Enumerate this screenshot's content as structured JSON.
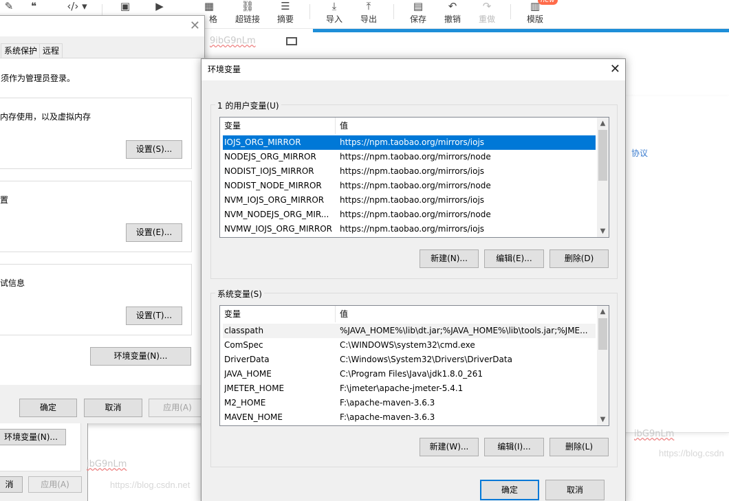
{
  "toolbar": {
    "items": [
      {
        "icon": "quote-icon",
        "glyph": "❝",
        "label": ""
      },
      {
        "icon": "code-icon",
        "glyph": "‹/›",
        "label": ""
      },
      {
        "icon": "image-icon",
        "glyph": "▣",
        "label": ""
      },
      {
        "icon": "video-icon",
        "glyph": "▶",
        "label": ""
      },
      {
        "icon": "table-icon",
        "glyph": "▦",
        "label": "格"
      },
      {
        "icon": "link-icon",
        "glyph": "⛓",
        "label": "超链接"
      },
      {
        "icon": "summary-icon",
        "glyph": "☰",
        "label": "摘要"
      },
      {
        "icon": "import-icon",
        "glyph": "⤓",
        "label": "导入"
      },
      {
        "icon": "export-icon",
        "glyph": "⤒",
        "label": "导出"
      },
      {
        "icon": "save-icon",
        "glyph": "▤",
        "label": "保存"
      },
      {
        "icon": "undo-icon",
        "glyph": "↶",
        "label": "撤销"
      },
      {
        "icon": "redo-icon",
        "glyph": "↷",
        "label": "重做"
      },
      {
        "icon": "template-icon",
        "glyph": "▥",
        "label": "模版"
      }
    ],
    "new_badge": "new"
  },
  "background": {
    "link_text": "协议",
    "watermark": "https://blog.csdn.net",
    "watermark_right": "https://blog.csdn",
    "squiggle1": "9ibG9nLm",
    "squiggle2": "ibG9nLm",
    "squiggle3": "ibG9nLm"
  },
  "sysprop": {
    "tabs": [
      "系统保护",
      "远程"
    ],
    "admin_note": "须作为管理员登录。",
    "perf_text": "内存使用，以及虚拟内存",
    "perf_button": "设置(S)...",
    "profile_text": "置",
    "profile_button": "设置(E)...",
    "startup_text": "试信息",
    "startup_button": "设置(T)...",
    "env_button": "环境变量(N)...",
    "ok": "确定",
    "cancel": "取消",
    "apply": "应用(A)"
  },
  "sysprop2": {
    "env_button": "环境变量(N)...",
    "cancel": "消",
    "apply": "应用(A)"
  },
  "env_dialog": {
    "title": "环境变量",
    "user_section": {
      "legend": "1 的用户变量(U)",
      "col_name": "变量",
      "col_value": "值",
      "rows": [
        {
          "name": "IOJS_ORG_MIRROR",
          "value": "https://npm.taobao.org/mirrors/iojs"
        },
        {
          "name": "NODEJS_ORG_MIRROR",
          "value": "https://npm.taobao.org/mirrors/node"
        },
        {
          "name": "NODIST_IOJS_MIRROR",
          "value": "https://npm.taobao.org/mirrors/iojs"
        },
        {
          "name": "NODIST_NODE_MIRROR",
          "value": "https://npm.taobao.org/mirrors/node"
        },
        {
          "name": "NVM_IOJS_ORG_MIRROR",
          "value": "https://npm.taobao.org/mirrors/iojs"
        },
        {
          "name": "NVM_NODEJS_ORG_MIR...",
          "value": "https://npm.taobao.org/mirrors/node"
        },
        {
          "name": "NVMW_IOJS_ORG_MIRROR",
          "value": "https://npm.taobao.org/mirrors/iojs"
        }
      ],
      "selected_index": 0,
      "new_button": "新建(N)...",
      "edit_button": "编辑(E)...",
      "delete_button": "删除(D)"
    },
    "system_section": {
      "legend": "系统变量(S)",
      "col_name": "变量",
      "col_value": "值",
      "rows": [
        {
          "name": "classpath",
          "value": "%JAVA_HOME%\\lib\\dt.jar;%JAVA_HOME%\\lib\\tools.jar;%JME..."
        },
        {
          "name": "ComSpec",
          "value": "C:\\WINDOWS\\system32\\cmd.exe"
        },
        {
          "name": "DriverData",
          "value": "C:\\Windows\\System32\\Drivers\\DriverData"
        },
        {
          "name": "JAVA_HOME",
          "value": "C:\\Program Files\\Java\\jdk1.8.0_261"
        },
        {
          "name": "JMETER_HOME",
          "value": "F:\\jmeter\\apache-jmeter-5.4.1"
        },
        {
          "name": "M2_HOME",
          "value": "F:\\apache-maven-3.6.3"
        },
        {
          "name": "MAVEN_HOME",
          "value": "F:\\apache-maven-3.6.3"
        }
      ],
      "hover_index": 0,
      "new_button": "新建(W)...",
      "edit_button": "编辑(I)...",
      "delete_button": "删除(L)"
    },
    "ok": "确定",
    "cancel": "取消"
  }
}
